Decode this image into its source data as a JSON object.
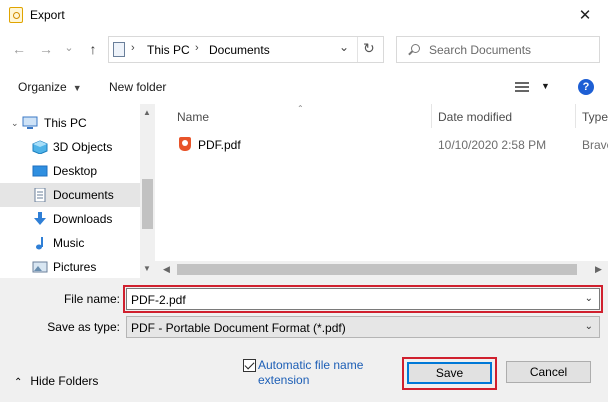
{
  "window": {
    "title": "Export",
    "close_glyph": "✕"
  },
  "nav": {
    "back_glyph": "←",
    "forward_glyph": "→",
    "recent_glyph": "⌄",
    "up_glyph": "↑",
    "breadcrumbs": [
      "This PC",
      "Documents"
    ],
    "refresh_glyph": "↻",
    "dropdown_glyph": "⌄"
  },
  "search": {
    "placeholder": "Search Documents"
  },
  "toolbar": {
    "organize_label": "Organize",
    "new_folder_label": "New folder",
    "help_label": "?"
  },
  "sidebar": {
    "items": [
      {
        "label": "This PC"
      },
      {
        "label": "3D Objects"
      },
      {
        "label": "Desktop"
      },
      {
        "label": "Documents"
      },
      {
        "label": "Downloads"
      },
      {
        "label": "Music"
      },
      {
        "label": "Pictures"
      }
    ]
  },
  "file_list": {
    "columns": {
      "name": "Name",
      "date_modified": "Date modified",
      "type": "Type"
    },
    "rows": [
      {
        "name": "PDF.pdf",
        "date_modified": "10/10/2020 2:58 PM",
        "type": "Brave"
      }
    ]
  },
  "form": {
    "file_name_label": "File name:",
    "file_name_value": "PDF-2.pdf",
    "save_type_label": "Save as type:",
    "save_type_value": "PDF - Portable Document Format (*.pdf)"
  },
  "footer": {
    "hide_folders_label": "Hide Folders",
    "auto_extension_label": "Automatic file name extension",
    "auto_extension_checked": true,
    "save_label": "Save",
    "cancel_label": "Cancel"
  },
  "colors": {
    "highlight_red": "#d0202e",
    "link_blue": "#1d5fb6",
    "accent_blue": "#0078d7"
  }
}
